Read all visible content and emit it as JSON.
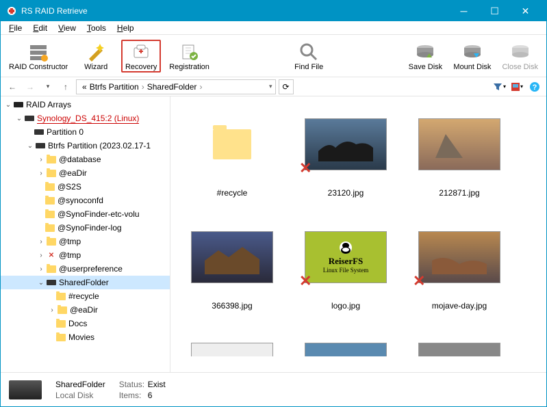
{
  "window": {
    "title": "RS RAID Retrieve"
  },
  "menu": {
    "file": "File",
    "edit": "Edit",
    "view": "View",
    "tools": "Tools",
    "help": "Help"
  },
  "toolbar": {
    "raid_constructor": "RAID Constructor",
    "wizard": "Wizard",
    "recovery": "Recovery",
    "registration": "Registration",
    "find_file": "Find File",
    "save_disk": "Save Disk",
    "mount_disk": "Mount Disk",
    "close_disk": "Close Disk"
  },
  "breadcrumb": {
    "prefix": "«",
    "seg1": "Btrfs Partition",
    "seg2": "SharedFolder",
    "sep": "›"
  },
  "tree": {
    "root": "RAID Arrays",
    "synology": "Synology_DS_415:2 (Linux)",
    "partition0": "Partition 0",
    "btrfs": "Btrfs Partition (2023.02.17-1",
    "items": [
      "@database",
      "@eaDir",
      "@S2S",
      "@synoconfd",
      "@SynoFinder-etc-volu",
      "@SynoFinder-log",
      "@tmp",
      "@tmp",
      "@userpreference",
      "SharedFolder"
    ],
    "sub": [
      "#recycle",
      "@eaDir",
      "Docs",
      "Movies"
    ]
  },
  "files": [
    {
      "name": "#recycle",
      "type": "folder",
      "deleted": false
    },
    {
      "name": "23120.jpg",
      "type": "image",
      "deleted": true,
      "bg": "rocks"
    },
    {
      "name": "212871.jpg",
      "type": "image",
      "deleted": false,
      "bg": "elcapitan"
    },
    {
      "name": "366398.jpg",
      "type": "image",
      "deleted": false,
      "bg": "sierra"
    },
    {
      "name": "logo.jpg",
      "type": "image",
      "deleted": true,
      "bg": "reiserfs",
      "caption1": "ReiserFS",
      "caption2": "Linux File System"
    },
    {
      "name": "mojave-day.jpg",
      "type": "image",
      "deleted": true,
      "bg": "mojave"
    }
  ],
  "status": {
    "name": "SharedFolder",
    "type": "Local Disk",
    "status_label": "Status:",
    "status_value": "Exist",
    "items_label": "Items:",
    "items_value": "6"
  }
}
